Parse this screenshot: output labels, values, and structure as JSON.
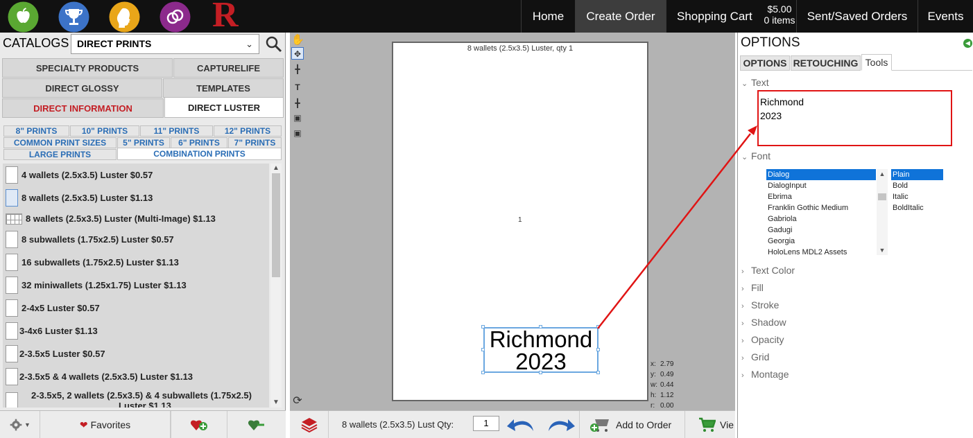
{
  "topbar": {
    "nav": [
      {
        "label": "Home",
        "active": false
      },
      {
        "label": "Create Order",
        "active": true
      },
      {
        "label": "Shopping Cart",
        "active": false
      },
      {
        "label": "Sent/Saved Orders",
        "active": false
      },
      {
        "label": "Events",
        "active": false
      }
    ],
    "cart_amount": "$5.00",
    "cart_items": "0 items",
    "logo_letter": "R",
    "app_icons": [
      "apple-icon",
      "trophy-icon",
      "silhouette-icon",
      "rings-icon"
    ],
    "colors": {
      "apple": "#5aa832",
      "trophy": "#3c73c8",
      "silhouette": "#e9a619",
      "rings": "#8c2a8c",
      "logo": "#c41e24"
    }
  },
  "catalogs": {
    "label": "CATALOGS",
    "selected": "DIRECT PRINTS",
    "tabs_row1": [
      "SPECIALTY PRODUCTS",
      "CAPTURELIFE"
    ],
    "tabs_row2": [
      "DIRECT GLOSSY",
      "TEMPLATES"
    ],
    "tabs_row3": [
      "DIRECT INFORMATION",
      "DIRECT LUSTER"
    ],
    "sub_row1": [
      "8\" PRINTS",
      "10\" PRINTS",
      "11\" PRINTS",
      "12\" PRINTS"
    ],
    "sub_row2": [
      "COMMON PRINT SIZES",
      "5\" PRINTS",
      "6\" PRINTS",
      "7\" PRINTS"
    ],
    "sub_row3": [
      "LARGE PRINTS",
      "COMBINATION PRINTS"
    ]
  },
  "products": [
    "4 wallets (2.5x3.5) Luster $0.57",
    "8 wallets (2.5x3.5) Luster $1.13",
    "8 wallets (2.5x3.5) Luster (Multi-Image) $1.13",
    "8 subwallets (1.75x2.5) Luster $0.57",
    "16 subwallets (1.75x2.5) Luster $1.13",
    "32 miniwallets (1.25x1.75) Luster $1.13",
    "2-4x5 Luster $0.57",
    "3-4x6 Luster $1.13",
    "2-3.5x5 Luster $0.57",
    "2-3.5x5 & 4 wallets (2.5x3.5) Luster $1.13",
    "2-3.5x5, 2 wallets (2.5x3.5) & 4 subwallets (1.75x2.5)",
    "Luster $1.13"
  ],
  "left_bottom": {
    "favorites": "Favorites"
  },
  "canvas": {
    "page_title": "8 wallets (2.5x3.5) Luster, qty 1",
    "page_number": "1",
    "text_line1": "Richmond",
    "text_line2": "2023",
    "coords": {
      "x": "2.79",
      "y": "0.49",
      "w": "0.44",
      "h": "1.12",
      "r": "0.00"
    }
  },
  "center_bottom": {
    "product_label": "8 wallets (2.5x3.5) Lust Qty:",
    "qty": "1",
    "add_to_order": "Add to Order",
    "view": "Vie"
  },
  "options": {
    "title": "OPTIONS",
    "tabs": [
      "OPTIONS",
      "RETOUCHING",
      "Tools"
    ],
    "text_section": "Text",
    "text_value": "Richmond\n2023",
    "font_section": "Font",
    "fonts": [
      "Dialog",
      "DialogInput",
      "Ebrima",
      "Franklin Gothic Medium",
      "Gabriola",
      "Gadugi",
      "Georgia",
      "HoloLens MDL2 Assets"
    ],
    "styles": [
      "Plain",
      "Bold",
      "Italic",
      "BoldItalic"
    ],
    "sections": [
      "Text Color",
      "Fill",
      "Stroke",
      "Shadow",
      "Opacity",
      "Grid",
      "Montage"
    ]
  }
}
